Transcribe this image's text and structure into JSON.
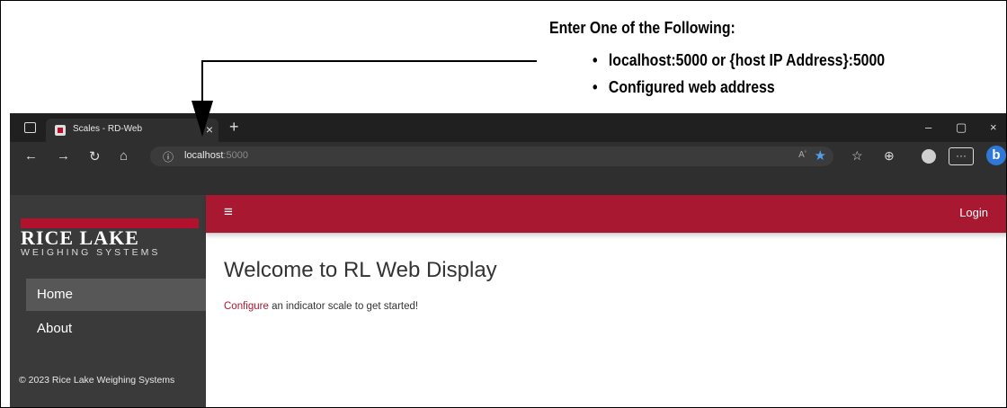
{
  "callout": {
    "title": "Enter One of the Following:",
    "bullets": [
      "localhost:5000 or {host IP Address}:5000",
      "Configured web address"
    ]
  },
  "browser": {
    "tab_title": "Scales - RD-Web",
    "tab_close": "×",
    "new_tab": "+",
    "window_controls": {
      "minimize": "–",
      "maximize": "▢",
      "close": "×"
    },
    "nav": {
      "back": "←",
      "forward": "→",
      "refresh": "↻",
      "home": "⌂"
    },
    "url_host": "localhost",
    "url_port": ":5000",
    "read_aloud": "Aʼ",
    "more_label": "···",
    "copilot_label": "b"
  },
  "app": {
    "logo_top": "RICE LAKE",
    "logo_bottom": "WEIGHING SYSTEMS",
    "nav_items": [
      {
        "label": "Home",
        "active": true
      },
      {
        "label": "About",
        "active": false
      }
    ],
    "copyright": "© 2023 Rice Lake Weighing Systems",
    "menu_icon": "≡",
    "login_label": "Login",
    "heading": "Welcome to RL Web Display",
    "configure_link": "Configure",
    "message_rest": " an indicator scale to get started!",
    "accent_color": "#a81831"
  }
}
